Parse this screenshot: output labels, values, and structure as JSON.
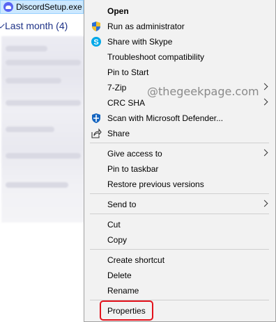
{
  "explorer": {
    "file_name": "DiscordSetup.exe",
    "group_label": "Last month (4)"
  },
  "menu": {
    "items": [
      {
        "label": "Open",
        "bold": true
      },
      {
        "label": "Run as administrator",
        "icon": "shield-icon"
      },
      {
        "label": "Share with Skype",
        "icon": "skype-icon"
      },
      {
        "label": "Troubleshoot compatibility"
      },
      {
        "label": "Pin to Start"
      },
      {
        "label": "7-Zip",
        "submenu": true
      },
      {
        "label": "CRC SHA",
        "submenu": true
      },
      {
        "label": "Scan with Microsoft Defender...",
        "icon": "defender-icon"
      },
      {
        "label": "Share",
        "icon": "share-icon"
      },
      {
        "label": "Give access to",
        "submenu": true
      },
      {
        "label": "Pin to taskbar"
      },
      {
        "label": "Restore previous versions"
      },
      {
        "label": "Send to",
        "submenu": true
      },
      {
        "label": "Cut"
      },
      {
        "label": "Copy"
      },
      {
        "label": "Create shortcut"
      },
      {
        "label": "Delete"
      },
      {
        "label": "Rename"
      },
      {
        "label": "Properties"
      }
    ]
  },
  "watermark": "@thegeekpage.com",
  "colors": {
    "menu_background": "#f2f2f2",
    "selection_background": "#cce8ff",
    "highlight_border": "#e3111b",
    "group_label": "#1e3287"
  }
}
